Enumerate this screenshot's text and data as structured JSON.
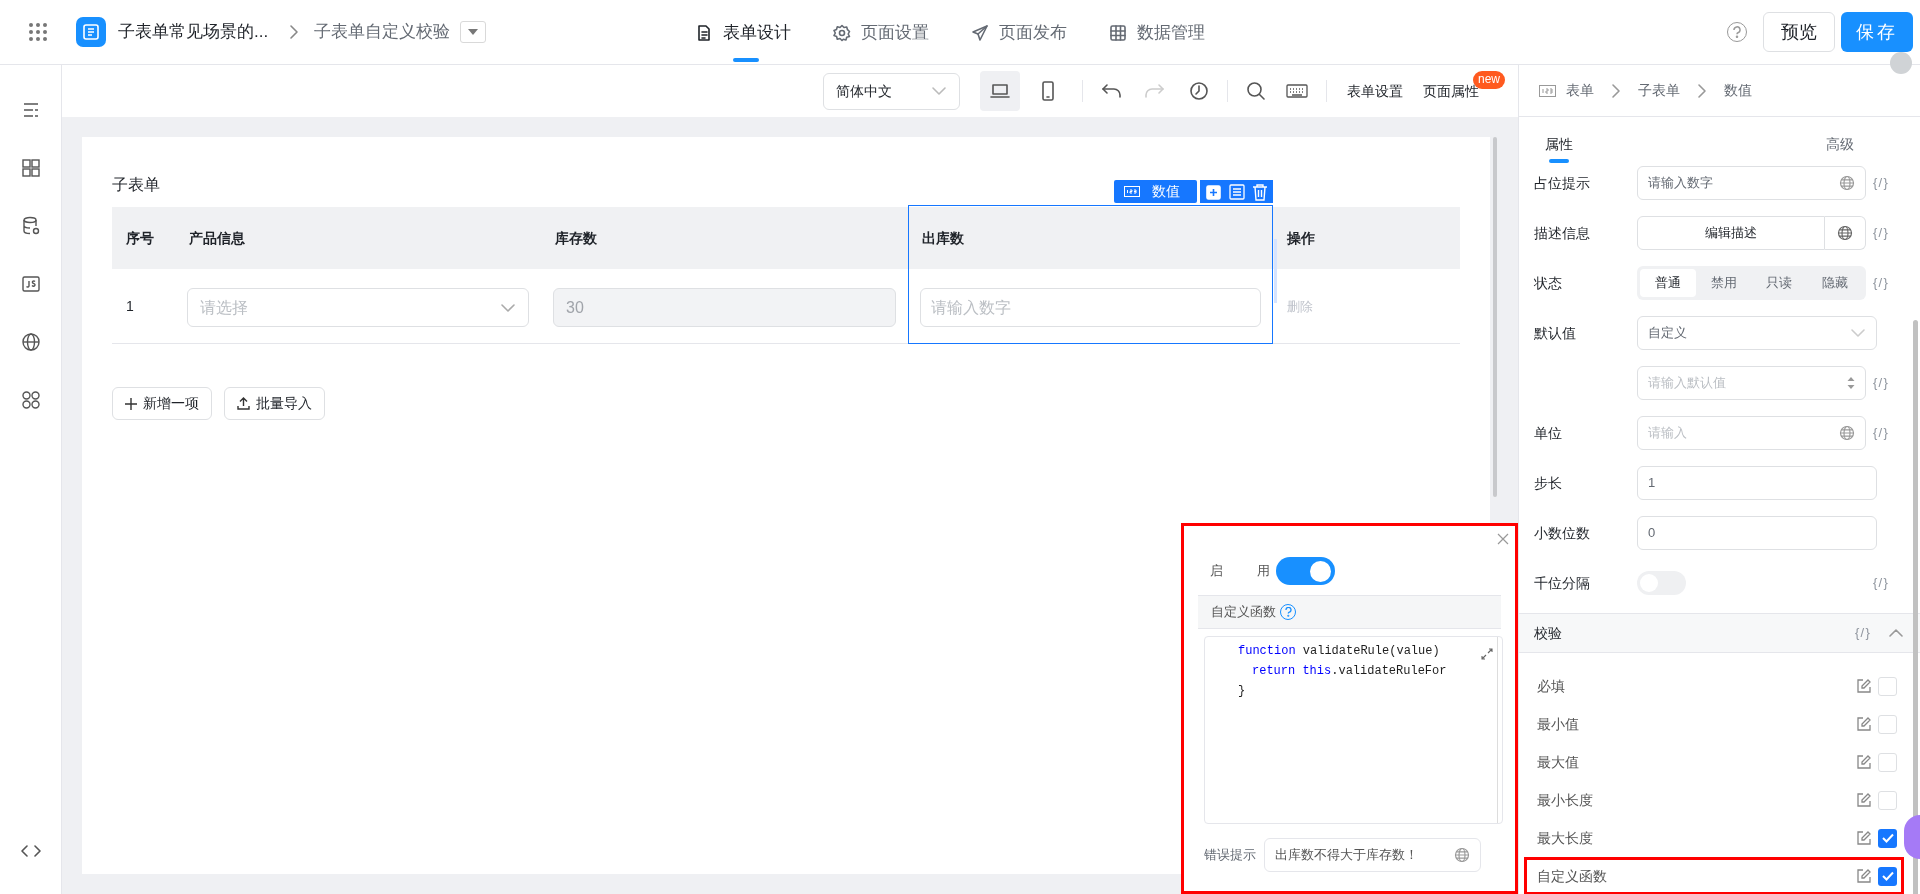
{
  "topbar": {
    "app_title": "子表单常见场景的...",
    "page_title": "子表单自定义校验",
    "nav_tabs": [
      {
        "label": "表单设计",
        "kind": "form",
        "selected": true
      },
      {
        "label": "页面设置",
        "kind": "settings",
        "selected": false
      },
      {
        "label": "页面发布",
        "kind": "publish",
        "selected": false
      },
      {
        "label": "数据管理",
        "kind": "data",
        "selected": false
      }
    ],
    "preview_button": "预览",
    "save_button": "保存"
  },
  "toolbar": {
    "language": "简体中文",
    "devices": [
      {
        "kind": "desktop",
        "selected": true
      },
      {
        "kind": "mobile",
        "selected": false
      }
    ],
    "links": [
      "表单设置",
      "页面属性"
    ],
    "new_badge": "new"
  },
  "subform": {
    "title": "子表单",
    "columns": [
      "序号",
      "产品信息",
      "库存数",
      "出库数",
      "操作"
    ],
    "rows": [
      {
        "index": "1",
        "product_placeholder": "请选择",
        "stock": "30",
        "outbound_placeholder": "请输入数字",
        "action": "删除"
      }
    ],
    "selected_badge": "数值",
    "buttons": [
      {
        "label": "新增一项",
        "kind": "add"
      },
      {
        "label": "批量导入",
        "kind": "import"
      }
    ]
  },
  "properties": {
    "expression_marker": "{/}",
    "breadcrumb": [
      "表单",
      "子表单",
      "数值"
    ],
    "tabs": [
      {
        "label": "属性",
        "selected": true
      },
      {
        "label": "高级",
        "selected": false
      }
    ],
    "fields": [
      {
        "kind": "input",
        "label": "占位提示",
        "value": "请输入数字",
        "i18n": true,
        "expression": true
      },
      {
        "kind": "button",
        "label": "描述信息",
        "value": "编辑描述",
        "i18n": true,
        "expression": true
      },
      {
        "kind": "segmented",
        "label": "状态",
        "options": [
          {
            "label": "普通",
            "selected": true
          },
          {
            "label": "禁用",
            "selected": false
          },
          {
            "label": "只读",
            "selected": false
          },
          {
            "label": "隐藏",
            "selected": false
          }
        ],
        "expression": true
      },
      {
        "kind": "select",
        "label": "默认值",
        "value": "自定义",
        "expression": false
      },
      {
        "kind": "number",
        "placeholder": "请输入默认值",
        "expression": true
      },
      {
        "kind": "input",
        "label": "单位",
        "placeholder": "请输入",
        "i18n": true,
        "expression": true
      },
      {
        "kind": "input",
        "label": "步长",
        "value": "1",
        "i18n": false,
        "expression": false
      },
      {
        "kind": "input",
        "label": "小数位数",
        "value": "0",
        "i18n": false,
        "expression": false
      },
      {
        "kind": "switch",
        "label": "千位分隔",
        "on": false,
        "expression": true
      }
    ],
    "validation": {
      "title": "校验",
      "expanded": true,
      "expression": true,
      "rules": [
        {
          "label": "必填",
          "checked": false,
          "highlighted": false
        },
        {
          "label": "最小值",
          "checked": false,
          "highlighted": false
        },
        {
          "label": "最大值",
          "checked": false,
          "highlighted": false
        },
        {
          "label": "最小长度",
          "checked": false,
          "highlighted": false
        },
        {
          "label": "最大长度",
          "checked": true,
          "highlighted": false
        },
        {
          "label": "自定义函数",
          "checked": true,
          "highlighted": true
        }
      ]
    }
  },
  "popup": {
    "enable_label": [
      "启",
      "用"
    ],
    "enabled": true,
    "section": "自定义函数",
    "code": [
      {
        "tokens": [
          {
            "kind": "keyword",
            "text": "function"
          },
          {
            "kind": "plain",
            "text": " validateRule(value)"
          }
        ],
        "children": [
          {
            "tokens": [
              {
                "kind": "keyword",
                "text": "return"
              },
              {
                "kind": "keyword",
                "text": " this"
              },
              {
                "kind": "plain",
                "text": ".validateRuleFor"
              }
            ]
          }
        ]
      },
      {
        "tokens": [
          {
            "kind": "plain",
            "text": "}"
          }
        ]
      }
    ],
    "error_label": "错误提示",
    "error_message": "出库数不得大于库存数！"
  }
}
